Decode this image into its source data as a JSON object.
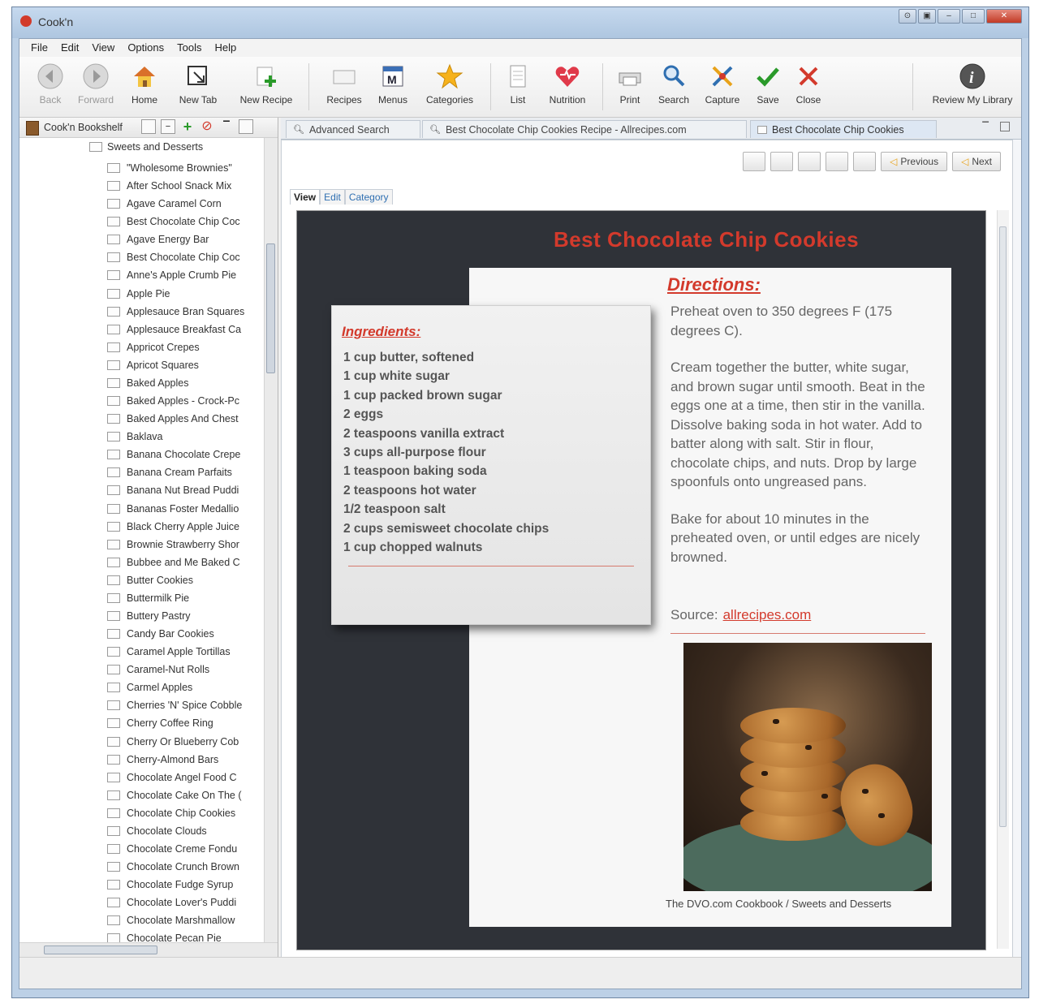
{
  "window": {
    "title": "Cook'n"
  },
  "menu": [
    "File",
    "Edit",
    "View",
    "Options",
    "Tools",
    "Help"
  ],
  "toolbar": {
    "back": "Back",
    "forward": "Forward",
    "home": "Home",
    "new_tab": "New Tab",
    "new_recipe": "New Recipe",
    "recipes": "Recipes",
    "menus": "Menus",
    "categories": "Categories",
    "list": "List",
    "nutrition": "Nutrition",
    "print": "Print",
    "search": "Search",
    "capture": "Capture",
    "save": "Save",
    "close": "Close",
    "review": "Review My Library"
  },
  "sidebar": {
    "title": "Cook'n Bookshelf",
    "root": "Sweets and Desserts",
    "items": [
      "\"Wholesome Brownies\"",
      "After School Snack Mix",
      "Agave Caramel Corn",
      "Best Chocolate Chip Coc",
      "Agave Energy Bar",
      "Best Chocolate Chip Coc",
      "Anne's Apple Crumb Pie",
      "Apple Pie",
      "Applesauce Bran Squares",
      "Applesauce Breakfast Ca",
      "Appricot Crepes",
      "Apricot Squares",
      "Baked Apples",
      "Baked Apples - Crock-Pc",
      "Baked Apples And Chest",
      "Baklava",
      "Banana Chocolate Crepe",
      "Banana Cream Parfaits",
      "Banana Nut Bread Puddi",
      "Bananas Foster Medallio",
      "Black Cherry Apple Juice",
      "Brownie Strawberry Shor",
      "Bubbee and Me Baked C",
      "Butter Cookies",
      "Buttermilk Pie",
      "Buttery Pastry",
      "Candy Bar Cookies",
      "Caramel Apple Tortillas",
      "Caramel-Nut Rolls",
      "Carmel Apples",
      "Cherries 'N' Spice Cobble",
      "Cherry Coffee Ring",
      "Cherry Or Blueberry Cob",
      "Cherry-Almond Bars",
      "Chocolate Angel Food C",
      "Chocolate Cake On The (",
      "Chocolate Chip Cookies",
      "Chocolate Clouds",
      "Chocolate Creme Fondu",
      "Chocolate Crunch Brown",
      "Chocolate Fudge Syrup",
      "Chocolate Lover's Puddi",
      "Chocolate Marshmallow",
      "Chocolate Pecan Pie"
    ]
  },
  "tabs": [
    "Advanced Search",
    "Best Chocolate Chip Cookies Recipe - Allrecipes.com",
    "Best Chocolate Chip Cookies"
  ],
  "nav": {
    "previous": "Previous",
    "next": "Next"
  },
  "subtabs": [
    "View",
    "Edit",
    "Category"
  ],
  "recipe": {
    "title": "Best Chocolate Chip Cookies",
    "ingredients_heading": "Ingredients:",
    "ingredients": [
      "1 cup butter, softened",
      "1 cup white sugar",
      "1 cup packed brown sugar",
      "2 eggs",
      "2 teaspoons vanilla extract",
      "3 cups all-purpose flour",
      "1 teaspoon baking soda",
      "2 teaspoons hot water",
      "1/2 teaspoon salt",
      "2 cups semisweet chocolate chips",
      "1 cup chopped walnuts"
    ],
    "directions_heading": "Directions:",
    "directions": [
      "Preheat oven to 350 degrees F (175 degrees C).",
      "Cream together the butter, white sugar, and brown sugar until smooth. Beat in the eggs one at a time, then stir in the vanilla. Dissolve baking soda in hot water. Add to batter along with salt. Stir in flour, chocolate chips, and nuts. Drop by large spoonfuls onto ungreased pans.",
      "Bake for about 10 minutes in the preheated oven, or until edges are nicely browned."
    ],
    "source_label": "Source:",
    "source_link": "allrecipes.com",
    "caption": "The DVO.com Cookbook / Sweets and Desserts"
  },
  "colors": {
    "accent": "#d33a2c",
    "recipe_background": "#2f3238"
  }
}
